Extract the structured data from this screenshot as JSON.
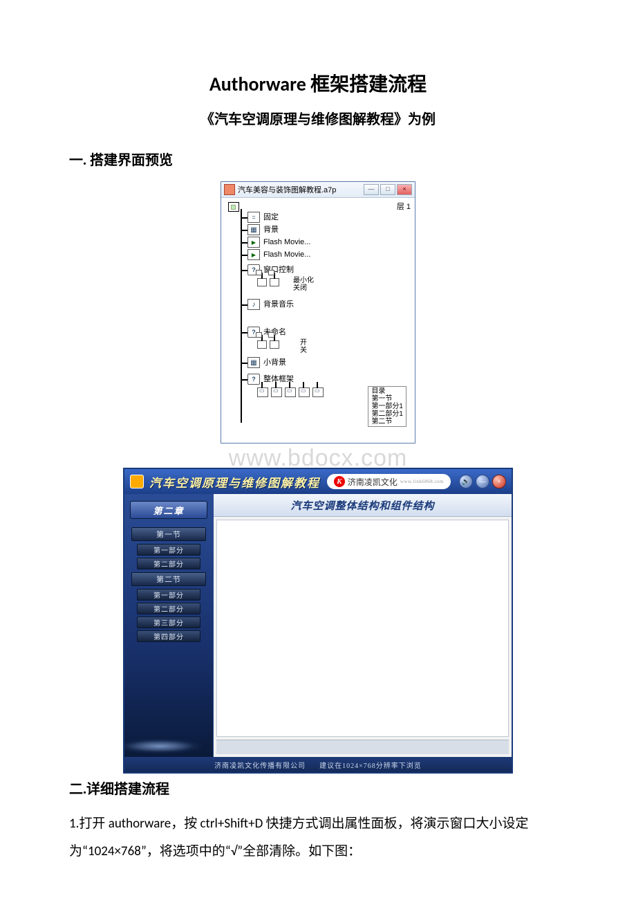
{
  "doc": {
    "title": "Authorware 框架搭建流程",
    "subtitle": "《汽车空调原理与维修图解教程》为例",
    "section1": "一. 搭建界面预览",
    "section2": "二.详细搭建流程",
    "para1": "1.打开 authorware，按 ctrl+Shift+D 快捷方式调出属性面板，将演示窗口大小设定为“1024×768”，将选项中的“√”全部清除。如下图："
  },
  "watermark": "www.bdocx.com",
  "fig1": {
    "title": "汽车美容与装饰图解教程.a7p",
    "layer": "层 1",
    "winbtn": {
      "min": "—",
      "max": "□",
      "close": "×"
    },
    "items": {
      "i1": "固定",
      "i2": "背景",
      "i3": "Flash Movie...",
      "i4": "Flash Movie...",
      "i5": "窗口控制",
      "i5a": "最小化",
      "i5b": "关闭",
      "i6": "背景音乐",
      "i7": "未命名",
      "i7a": "开",
      "i7b": "关",
      "i8": "小背景",
      "i9": "整体框架",
      "i9list": [
        "目录",
        "第一节",
        "第一部分1",
        "第二部分1",
        "第二节"
      ]
    }
  },
  "fig2": {
    "title": "汽车空调原理与维修图解教程",
    "brand": {
      "k": "K",
      "cn": "济南凌凯文化",
      "en": "www.link6868.com"
    },
    "btn_sound": "🔊",
    "btn_min": "—",
    "btn_close": "×",
    "chapter": "第二章",
    "content_title": "汽车空调整体结构和组件结构",
    "sidebar": {
      "s1": "第一节",
      "s1a": "第一部分",
      "s1b": "第二部分",
      "s2": "第二节",
      "s2a": "第一部分",
      "s2b": "第二部分",
      "s2c": "第三部分",
      "s2d": "第四部分"
    },
    "footer": {
      "a": "济南凌凯文化传播有限公司",
      "b": "建议在1024×768分辨率下浏览"
    }
  }
}
